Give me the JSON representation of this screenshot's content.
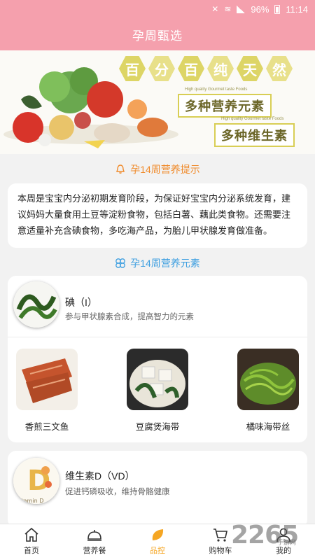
{
  "status": {
    "battery": "96%",
    "time": "11:14"
  },
  "header": {
    "title": "孕周甄选"
  },
  "banner": {
    "hex_chars": [
      "百",
      "分",
      "百",
      "纯",
      "天",
      "然"
    ],
    "tag1": "多种营养元素",
    "tag2": "多种维生素",
    "small_text": "High quality Gourmet taste Foods"
  },
  "tip": {
    "heading": "孕14周营养提示",
    "body": "本周是宝宝内分泌初期发育阶段，为保证好宝宝内分泌系统发育，建议妈妈大量食用土豆等淀粉食物，包括白薯、藕此类食物。还需要注意适量补充含碘食物，多吃海产品，为胎儿甲状腺发育做准备。"
  },
  "elements": {
    "heading": "孕14周营养元素",
    "items": [
      {
        "name": "碘（I）",
        "desc": "参与甲状腺素合成，提高智力的元素",
        "foods": [
          "香煎三文鱼",
          "豆腐煲海带",
          "橘味海带丝"
        ]
      },
      {
        "name": "维生素D（VD）",
        "desc": "促进钙磷吸收，维持骨骼健康",
        "thumb_letter": "D",
        "thumb_caption": "Vitamin D"
      }
    ]
  },
  "tabbar": {
    "items": [
      {
        "label": "首页",
        "icon": "home-icon"
      },
      {
        "label": "营养餐",
        "icon": "dish-cover-icon"
      },
      {
        "label": "品控",
        "icon": "leaf-icon",
        "active": true
      },
      {
        "label": "购物车",
        "icon": "cart-icon"
      },
      {
        "label": "我的",
        "icon": "user-icon"
      }
    ]
  },
  "watermark": {
    "text": "2265",
    "sub": "手游网"
  },
  "colors": {
    "header": "#f5a0ad",
    "active_tab": "#f5a623",
    "tip_heading": "#f08a2a",
    "elements_heading": "#3c9ee0"
  }
}
